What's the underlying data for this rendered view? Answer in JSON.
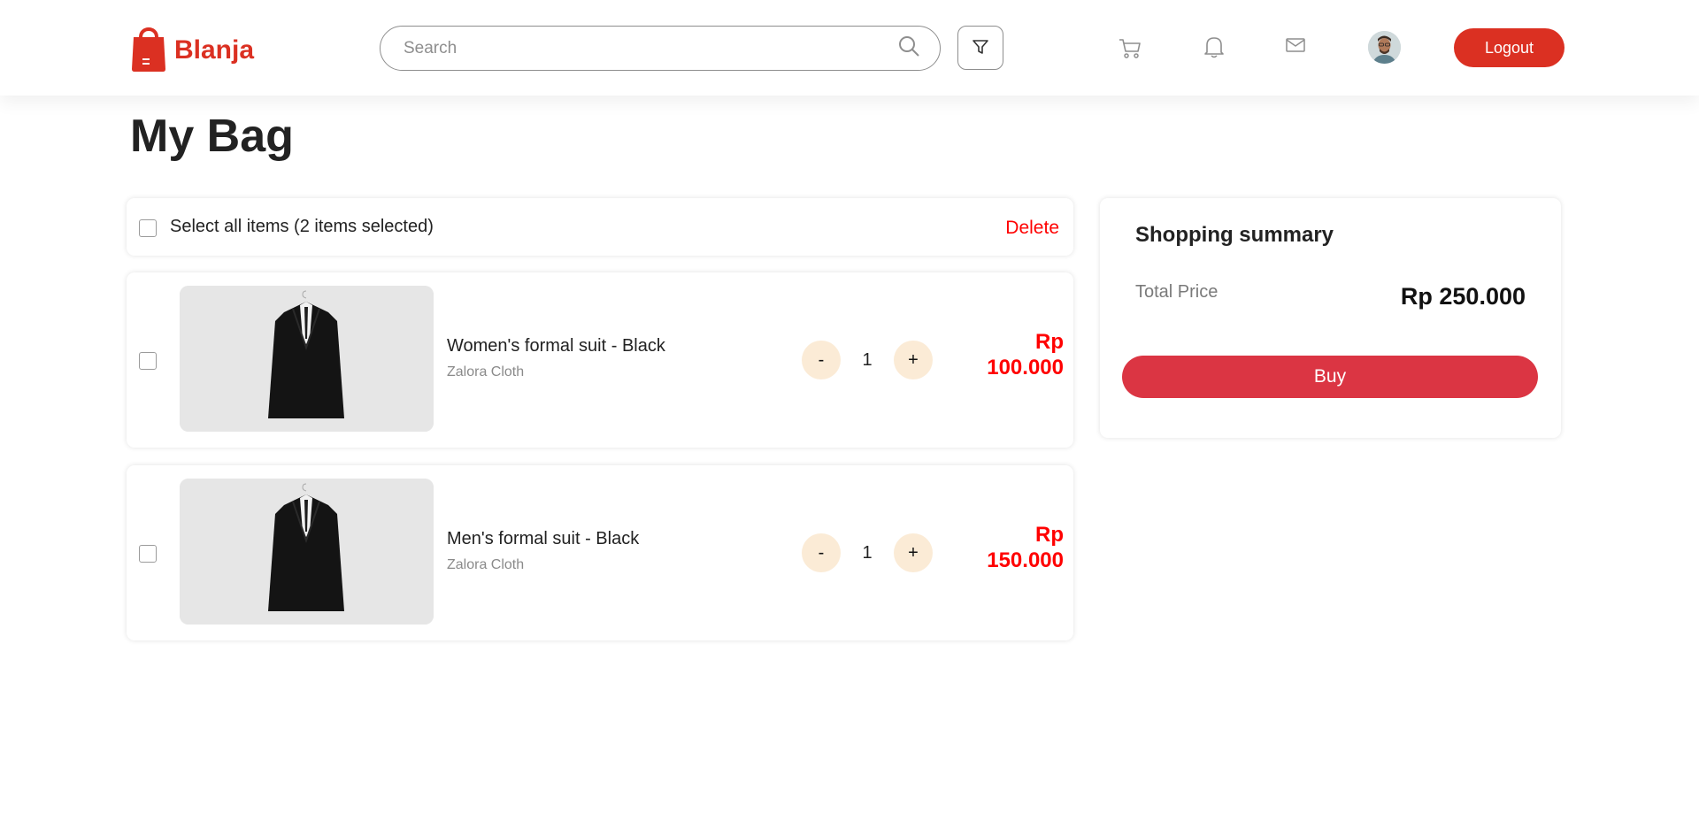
{
  "brand": {
    "name": "Blanja",
    "color": "#db3022"
  },
  "search": {
    "placeholder": "Search",
    "value": ""
  },
  "header": {
    "icons": [
      "search-icon",
      "filter-icon",
      "cart-icon",
      "bell-icon",
      "mail-icon"
    ],
    "logout_label": "Logout"
  },
  "page": {
    "title": "My Bag"
  },
  "bag": {
    "select_all_label": "Select all items (2 items selected)",
    "delete_label": "Delete",
    "items": [
      {
        "name": "Women's formal suit - Black",
        "store": "Zalora Cloth",
        "quantity": "1",
        "price_currency": "Rp",
        "price_amount": "100.000",
        "decrement": "-",
        "increment": "+"
      },
      {
        "name": "Men's formal suit - Black",
        "store": "Zalora Cloth",
        "quantity": "1",
        "price_currency": "Rp",
        "price_amount": "150.000",
        "decrement": "-",
        "increment": "+"
      }
    ]
  },
  "summary": {
    "title": "Shopping summary",
    "total_label": "Total Price",
    "total_value": "Rp 250.000",
    "buy_label": "Buy"
  },
  "colors": {
    "accent": "#db3022",
    "price": "#ff0000",
    "buy": "#db3543",
    "qty_button": "#fbebd6"
  }
}
